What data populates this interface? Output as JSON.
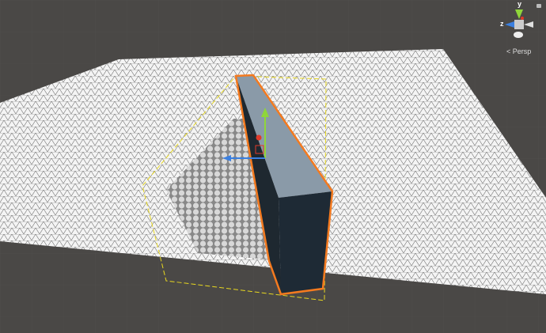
{
  "scene_view": {
    "gizmo": {
      "y_label": "y",
      "z_label": "z",
      "projection_label": "Persp",
      "x_color": "#e0e0e0",
      "y_color": "#8fd63a",
      "z_color": "#3a7fe0"
    },
    "selection_color": "#f47a1f",
    "bounds_color": "#e8d820"
  }
}
